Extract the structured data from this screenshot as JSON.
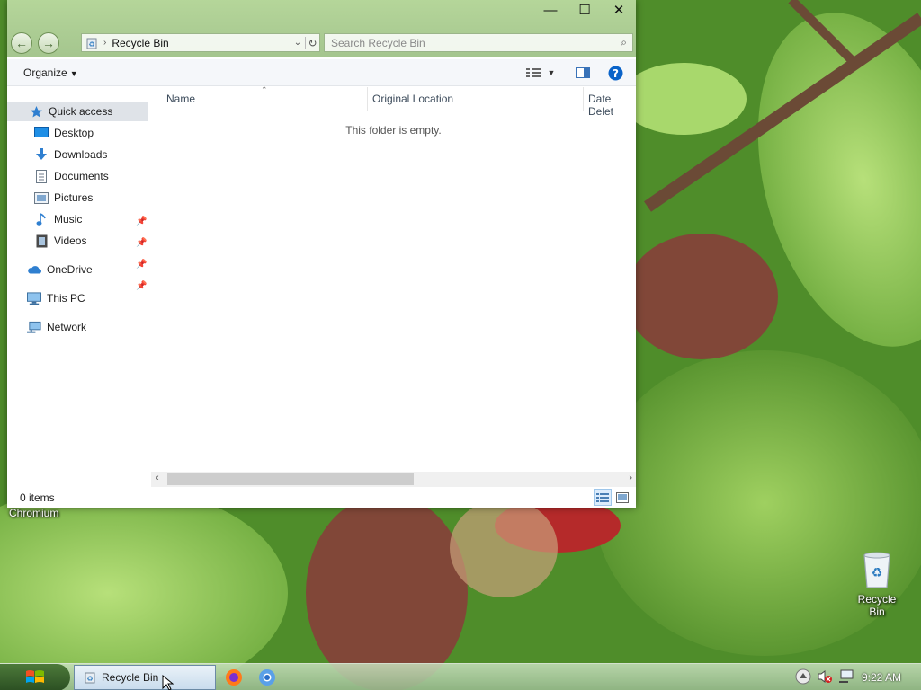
{
  "window": {
    "address_crumb": "Recycle Bin",
    "search_placeholder": "Search Recycle Bin",
    "organize_label": "Organize",
    "minimize_glyph": "—",
    "maximize_glyph": "☐",
    "close_glyph": "✕"
  },
  "nav": {
    "items": [
      {
        "label": "Quick access",
        "icon": "star-icon"
      },
      {
        "label": "Desktop",
        "icon": "desktop-icon"
      },
      {
        "label": "Downloads",
        "icon": "download-icon"
      },
      {
        "label": "Documents",
        "icon": "document-icon"
      },
      {
        "label": "Pictures",
        "icon": "pictures-icon"
      },
      {
        "label": "Music",
        "icon": "music-icon"
      },
      {
        "label": "Videos",
        "icon": "videos-icon"
      },
      {
        "label": "OneDrive",
        "icon": "cloud-icon"
      },
      {
        "label": "This PC",
        "icon": "computer-icon"
      },
      {
        "label": "Network",
        "icon": "network-icon"
      }
    ]
  },
  "columns": {
    "name": "Name",
    "original_location": "Original Location",
    "date_deleted": "Date Delet"
  },
  "content": {
    "empty_message": "This folder is empty."
  },
  "status": {
    "item_count": "0 items"
  },
  "desktop": {
    "chromium_label": "Chromium",
    "recycle_bin_label": "Recycle Bin"
  },
  "taskbar": {
    "active_window": "Recycle Bin",
    "clock": "9:22 AM"
  },
  "colors": {
    "accent": "#0a63c9",
    "selection": "#dfe3e8"
  }
}
